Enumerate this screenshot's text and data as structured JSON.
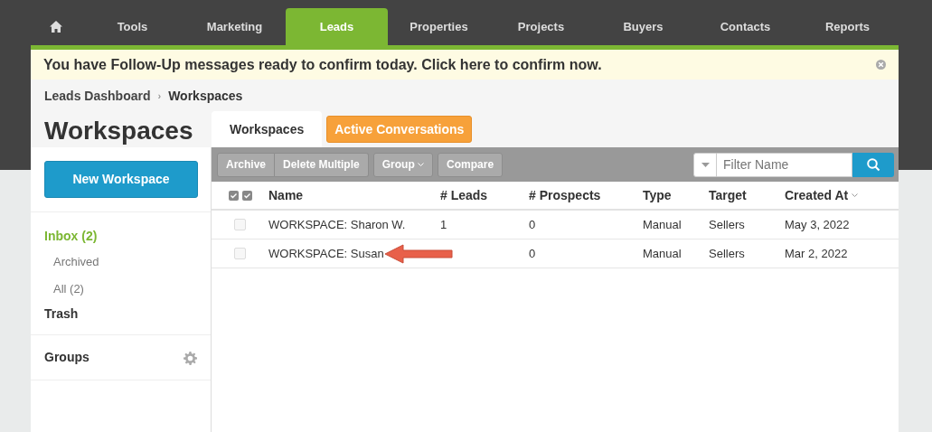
{
  "nav": [
    {
      "kind": "home",
      "selected": false
    },
    {
      "label": "Tools",
      "selected": false
    },
    {
      "label": "Marketing",
      "selected": false
    },
    {
      "label": "Leads",
      "selected": true
    },
    {
      "label": "Properties",
      "selected": false
    },
    {
      "label": "Projects",
      "selected": false
    },
    {
      "label": "Buyers",
      "selected": false
    },
    {
      "label": "Contacts",
      "selected": false
    },
    {
      "label": "Reports",
      "selected": false
    }
  ],
  "alert": {
    "text": "You have Follow-Up messages ready to confirm today. Click here to confirm now."
  },
  "breadcrumb": [
    "Leads Dashboard",
    "Workspaces"
  ],
  "breadcrumb_separator": "›",
  "page_title": "Workspaces",
  "tabs": [
    {
      "label": "Workspaces",
      "selected": true
    },
    {
      "label": "Active Conversations",
      "selected": false
    }
  ],
  "sidebar": {
    "new_button": "New Workspace",
    "items": [
      {
        "label": "Inbox (2)",
        "selected": true,
        "children": [
          {
            "label": "Archived",
            "selected": false
          },
          {
            "label": "All (2)",
            "selected": false
          }
        ]
      },
      {
        "label": "Trash",
        "selected": false
      }
    ],
    "groups": "Groups"
  },
  "toolbar": {
    "buttons": [
      {
        "label": "Archive",
        "dropdown": false
      },
      {
        "label": "Delete Multiple",
        "dropdown": false
      },
      {
        "label": "Group",
        "dropdown": true
      },
      {
        "label": "Compare",
        "dropdown": false
      }
    ],
    "filter": {
      "placeholder": "Filter Name"
    }
  },
  "table": {
    "select_all": {
      "checked": true
    },
    "columns": [
      {
        "label": "Name",
        "sorted": false
      },
      {
        "label": "# Leads",
        "sorted": false
      },
      {
        "label": "# Prospects",
        "sorted": false
      },
      {
        "label": "Type",
        "sorted": false
      },
      {
        "label": "Target",
        "sorted": false
      },
      {
        "label": "Created At",
        "sorted": true
      }
    ],
    "rows": [
      {
        "checked": false,
        "cells": [
          "WORKSPACE: Sharon W.",
          "1",
          "0",
          "Manual",
          "Sellers",
          "May 3, 2022"
        ],
        "arrow": false
      },
      {
        "checked": false,
        "cells": [
          "WORKSPACE: Susan",
          null,
          "0",
          "Manual",
          "Sellers",
          "Mar 2, 2022"
        ],
        "arrow": true
      }
    ]
  }
}
